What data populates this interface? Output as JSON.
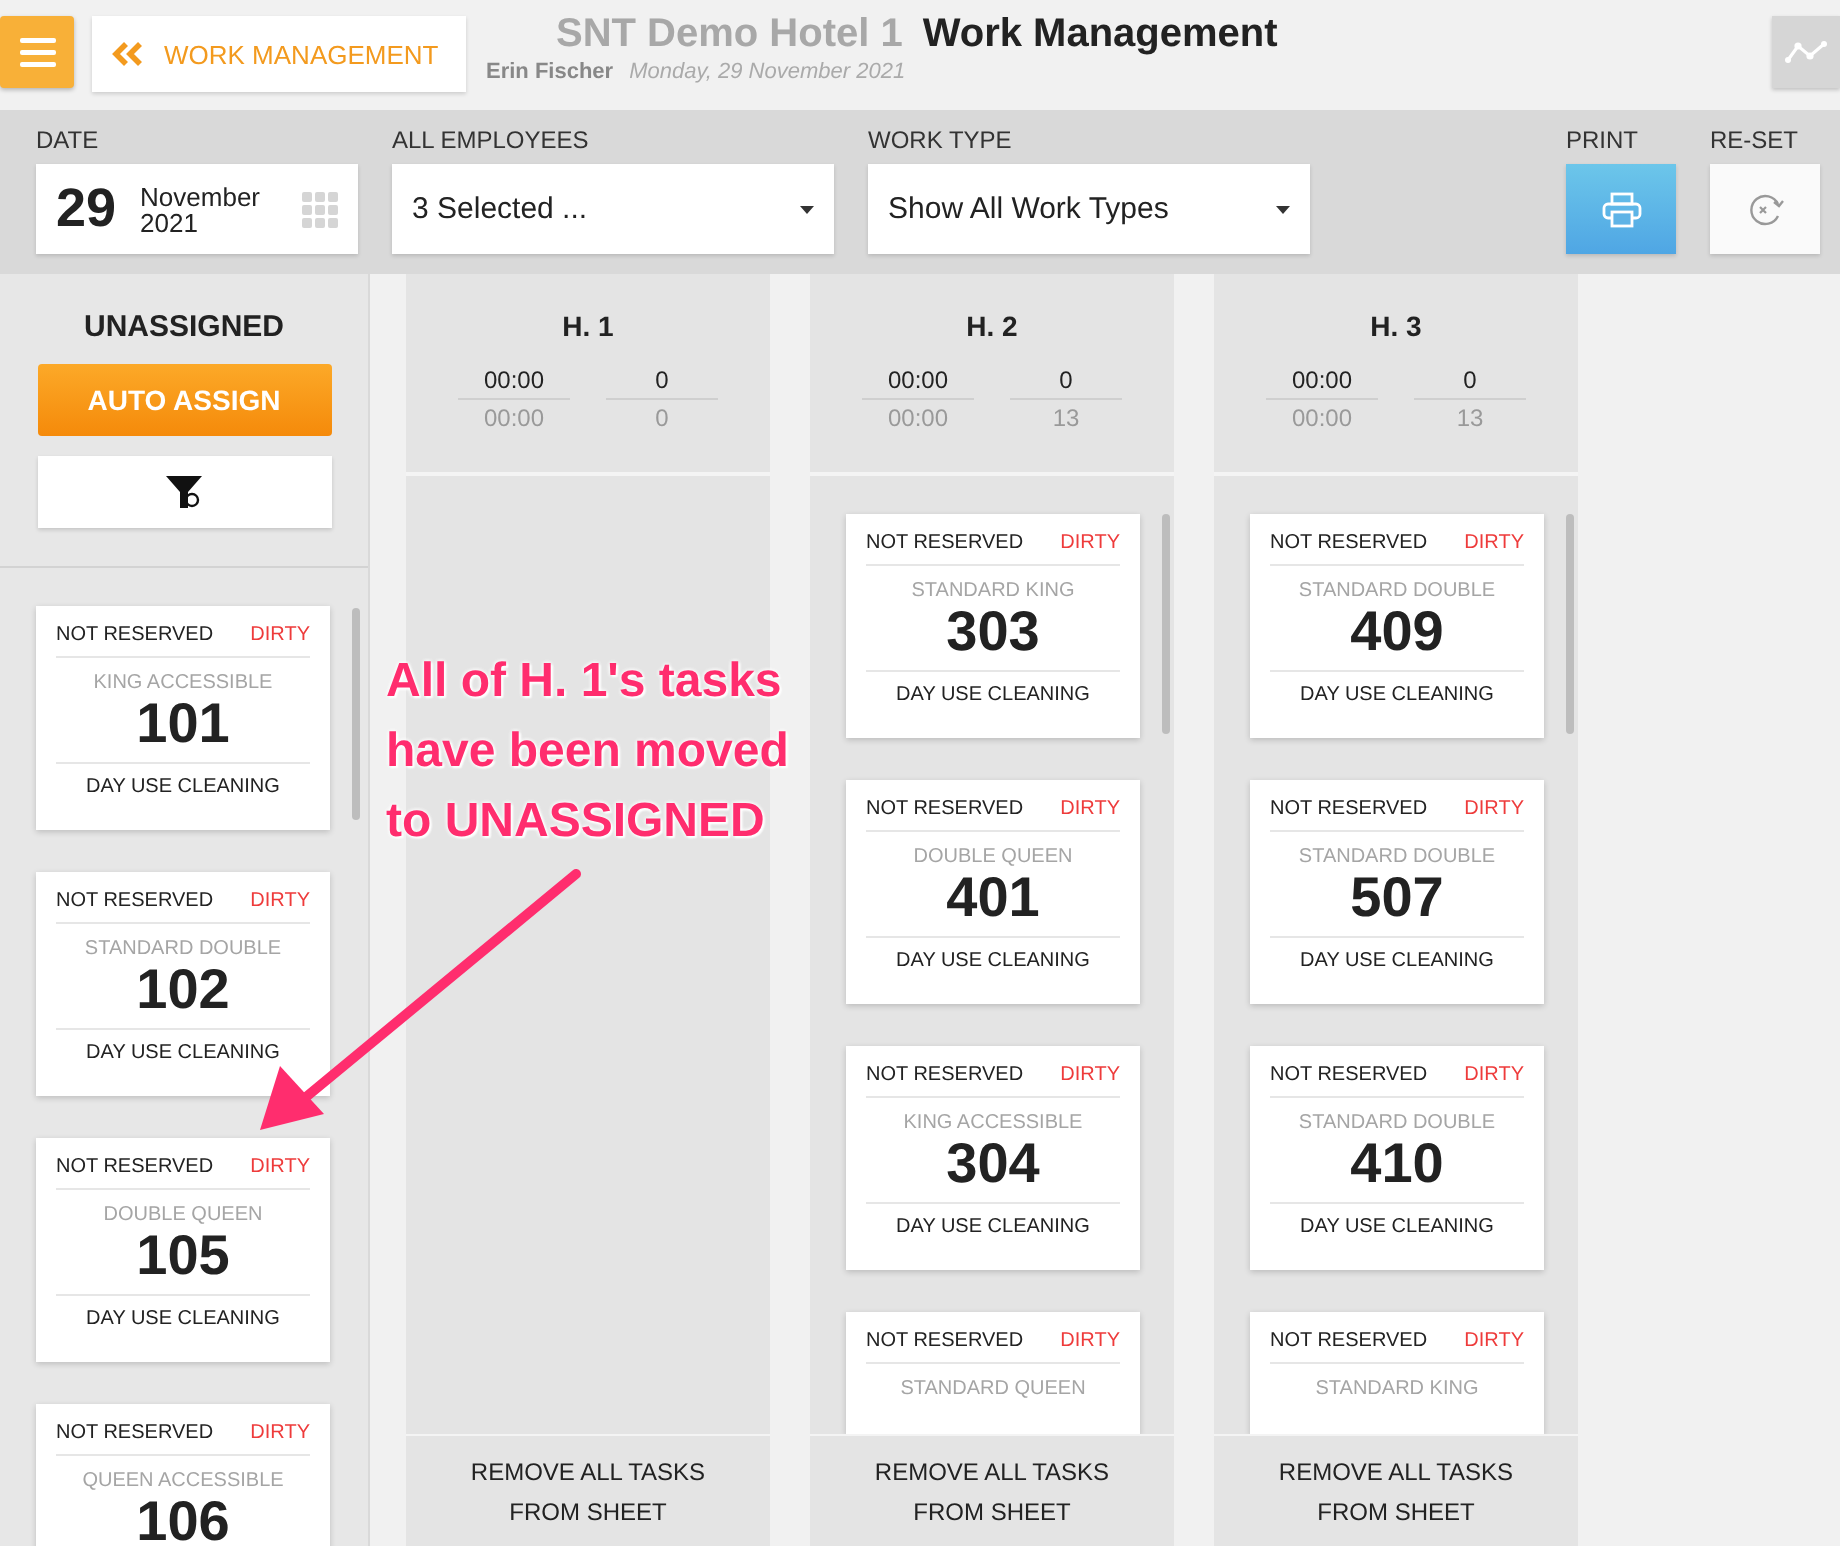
{
  "header": {
    "back_label": "WORK MANAGEMENT",
    "hotel": "SNT Demo Hotel 1",
    "title": "Work Management",
    "user": "Erin Fischer",
    "date": "Monday, 29 November 2021"
  },
  "filters": {
    "date_label": "DATE",
    "day": "29",
    "month": "November",
    "year": "2021",
    "employees_label": "ALL EMPLOYEES",
    "employees_value": "3 Selected ...",
    "work_type_label": "WORK TYPE",
    "work_type_value": "Show All Work Types",
    "print_label": "PRINT",
    "reset_label": "RE-SET"
  },
  "unassigned": {
    "title": "UNASSIGNED",
    "auto_assign": "AUTO ASSIGN",
    "tasks": [
      {
        "reservation": "NOT RESERVED",
        "status": "DIRTY",
        "room_type": "KING ACCESSIBLE",
        "room": "101",
        "work": "DAY USE CLEANING"
      },
      {
        "reservation": "NOT RESERVED",
        "status": "DIRTY",
        "room_type": "STANDARD DOUBLE",
        "room": "102",
        "work": "DAY USE CLEANING"
      },
      {
        "reservation": "NOT RESERVED",
        "status": "DIRTY",
        "room_type": "DOUBLE QUEEN",
        "room": "105",
        "work": "DAY USE CLEANING"
      },
      {
        "reservation": "NOT RESERVED",
        "status": "DIRTY",
        "room_type": "QUEEN ACCESSIBLE",
        "room": "106"
      }
    ]
  },
  "columns": [
    {
      "name": "H. 1",
      "time": "00:00",
      "time_total": "00:00",
      "count": "0",
      "count_total": "0",
      "footer": "REMOVE ALL TASKS FROM SHEET"
    },
    {
      "name": "H. 2",
      "time": "00:00",
      "time_total": "00:00",
      "count": "0",
      "count_total": "13",
      "footer": "REMOVE ALL TASKS FROM SHEET",
      "tasks": [
        {
          "reservation": "NOT RESERVED",
          "status": "DIRTY",
          "room_type": "STANDARD KING",
          "room": "303",
          "work": "DAY USE CLEANING"
        },
        {
          "reservation": "NOT RESERVED",
          "status": "DIRTY",
          "room_type": "DOUBLE QUEEN",
          "room": "401",
          "work": "DAY USE CLEANING"
        },
        {
          "reservation": "NOT RESERVED",
          "status": "DIRTY",
          "room_type": "KING ACCESSIBLE",
          "room": "304",
          "work": "DAY USE CLEANING"
        },
        {
          "reservation": "NOT RESERVED",
          "status": "DIRTY",
          "room_type": "STANDARD QUEEN"
        }
      ]
    },
    {
      "name": "H. 3",
      "time": "00:00",
      "time_total": "00:00",
      "count": "0",
      "count_total": "13",
      "footer": "REMOVE ALL TASKS FROM SHEET",
      "tasks": [
        {
          "reservation": "NOT RESERVED",
          "status": "DIRTY",
          "room_type": "STANDARD DOUBLE",
          "room": "409",
          "work": "DAY USE CLEANING"
        },
        {
          "reservation": "NOT RESERVED",
          "status": "DIRTY",
          "room_type": "STANDARD DOUBLE",
          "room": "507",
          "work": "DAY USE CLEANING"
        },
        {
          "reservation": "NOT RESERVED",
          "status": "DIRTY",
          "room_type": "STANDARD DOUBLE",
          "room": "410",
          "work": "DAY USE CLEANING"
        },
        {
          "reservation": "NOT RESERVED",
          "status": "DIRTY",
          "room_type": "STANDARD KING"
        }
      ]
    }
  ],
  "annotation": {
    "text": "All of H. 1's tasks\nhave been moved\nto UNASSIGNED"
  }
}
